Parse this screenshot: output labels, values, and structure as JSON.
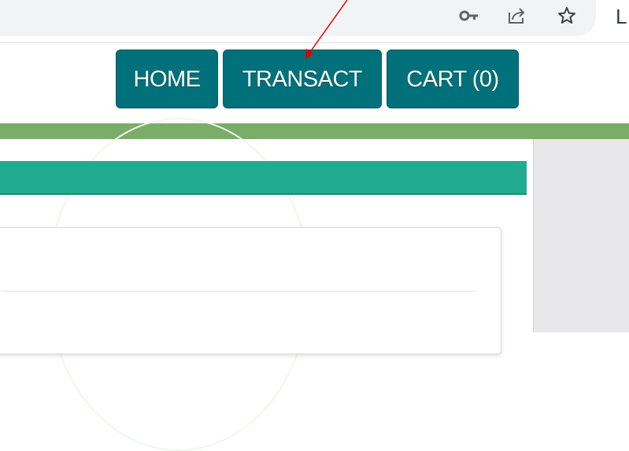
{
  "browser": {
    "profile_initial": "L",
    "icons": [
      "key-icon",
      "share-icon",
      "bookmark-star-icon"
    ]
  },
  "nav": {
    "home_label": "HOME",
    "transact_label": "TRANSACT",
    "cart_label": "CART (0)"
  },
  "colors": {
    "nav_button": "#00707a",
    "green_bar": "#7aad67",
    "teal_band": "#22ab8e",
    "annotation_arrow": "#e00000"
  }
}
